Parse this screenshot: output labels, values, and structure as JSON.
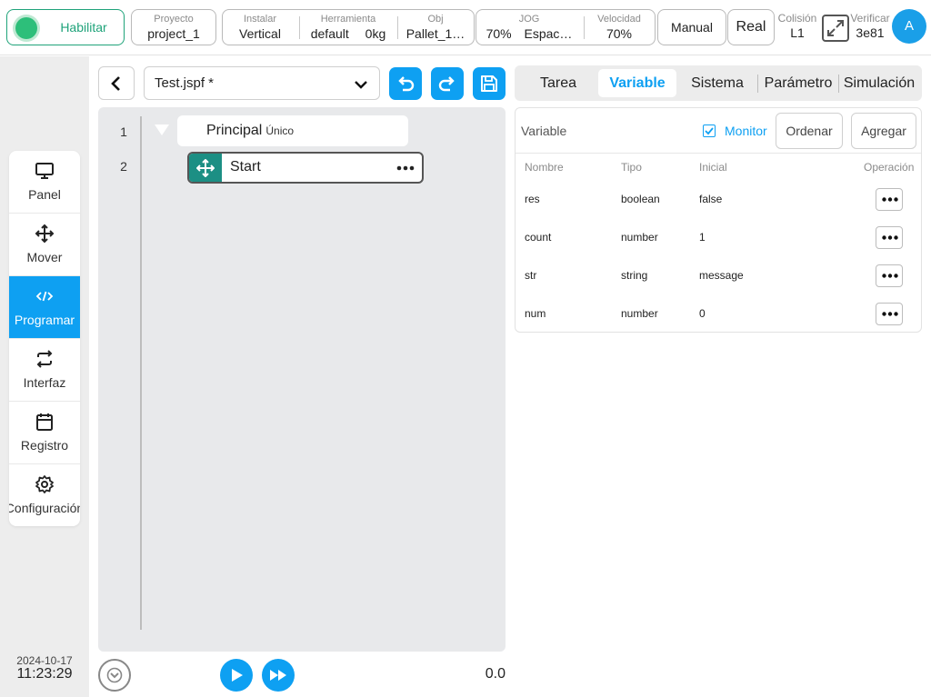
{
  "topbar": {
    "enable_label": "Habilitar",
    "proyecto": {
      "key": "Proyecto",
      "value": "project_1"
    },
    "instalar": {
      "key": "Instalar",
      "value": "Vertical"
    },
    "herramienta": {
      "key": "Herramienta",
      "value": "default"
    },
    "payload": {
      "value": "0kg"
    },
    "obj": {
      "key": "Obj",
      "value": "Pallet_1…"
    },
    "jog": {
      "key": "JOG",
      "value": "70%",
      "mode": "Espac…"
    },
    "velocidad": {
      "key": "Velocidad",
      "value": "70%"
    },
    "manual_label": "Manual",
    "real_label": "Real",
    "colision": {
      "key": "Colisión",
      "value": "L1"
    },
    "verificar": {
      "key": "Verificar",
      "value": "3e81"
    },
    "avatar_letter": "A"
  },
  "sidebar": {
    "items": [
      {
        "label": "Panel",
        "icon": "monitor-icon"
      },
      {
        "label": "Mover",
        "icon": "move-icon"
      },
      {
        "label": "Programar",
        "icon": "code-icon"
      },
      {
        "label": "Interfaz",
        "icon": "swap-icon"
      },
      {
        "label": "Registro",
        "icon": "calendar-icon"
      },
      {
        "label": "Configuración",
        "icon": "gear-icon"
      }
    ],
    "active_index": 2,
    "date": "2024-10-17",
    "time": "11:23:29"
  },
  "editor": {
    "file_name": "Test.jspf *",
    "lines": [
      "1",
      "2"
    ],
    "principal_title": "Principal",
    "principal_sub": "Único",
    "start_label": "Start",
    "speed_readout": "0.0"
  },
  "right_panel": {
    "tabs": [
      "Tarea",
      "Variable",
      "Sistema",
      "Parámetro",
      "Simulación"
    ],
    "active_tab": "Variable",
    "panel_title": "Variable",
    "monitor_label": "Monitor",
    "monitor_checked": true,
    "order_label": "Ordenar",
    "add_label": "Agregar",
    "columns": [
      "Nombre",
      "Tipo",
      "Inicial",
      "Operación"
    ],
    "rows": [
      {
        "name": "res",
        "type": "boolean",
        "initial": "false"
      },
      {
        "name": "count",
        "type": "number",
        "initial": "1"
      },
      {
        "name": "str",
        "type": "string",
        "initial": "message"
      },
      {
        "name": "num",
        "type": "number",
        "initial": "0"
      }
    ]
  },
  "colors": {
    "accent": "#0ea0f2",
    "enable_green": "#2dbf7a",
    "move_handle": "#1c8f84"
  }
}
